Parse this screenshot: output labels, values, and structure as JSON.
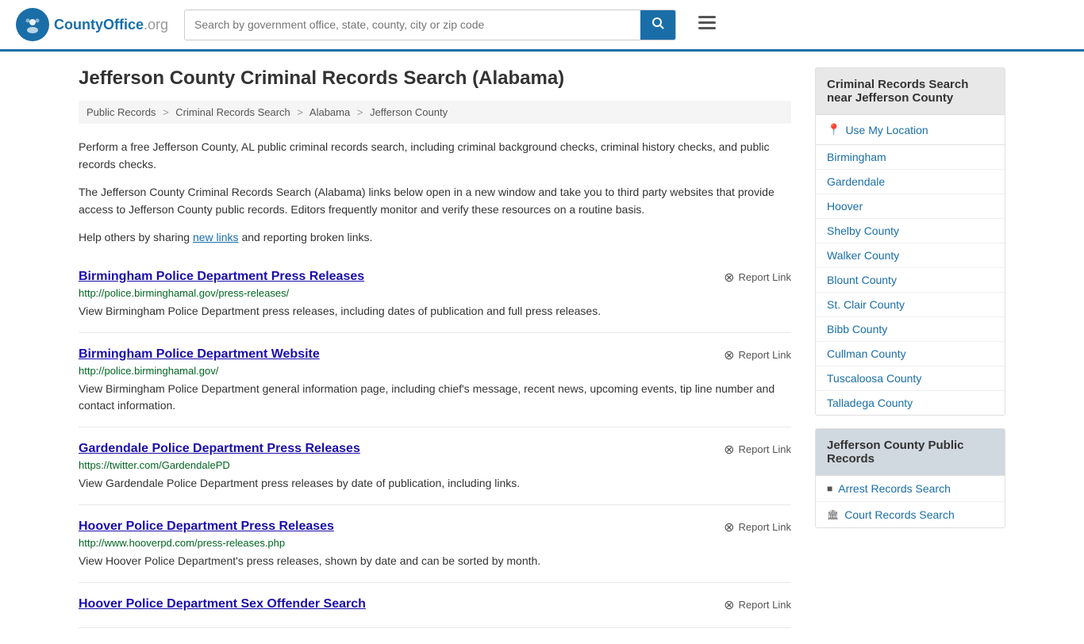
{
  "header": {
    "logo_text": "CountyOffice",
    "logo_suffix": ".org",
    "search_placeholder": "Search by government office, state, county, city or zip code"
  },
  "page": {
    "title": "Jefferson County Criminal Records Search (Alabama)",
    "breadcrumb": [
      {
        "label": "Public Records",
        "href": "#"
      },
      {
        "label": "Criminal Records Search",
        "href": "#"
      },
      {
        "label": "Alabama",
        "href": "#"
      },
      {
        "label": "Jefferson County",
        "href": "#"
      }
    ],
    "description_1": "Perform a free Jefferson County, AL public criminal records search, including criminal background checks, criminal history checks, and public records checks.",
    "description_2": "The Jefferson County Criminal Records Search (Alabama) links below open in a new window and take you to third party websites that provide access to Jefferson County public records. Editors frequently monitor and verify these resources on a routine basis.",
    "description_3_prefix": "Help others by sharing ",
    "description_3_link": "new links",
    "description_3_suffix": " and reporting broken links."
  },
  "results": [
    {
      "title": "Birmingham Police Department Press Releases",
      "url": "http://police.birminghamal.gov/press-releases/",
      "description": "View Birmingham Police Department press releases, including dates of publication and full press releases.",
      "report_label": "Report Link"
    },
    {
      "title": "Birmingham Police Department Website",
      "url": "http://police.birminghamal.gov/",
      "description": "View Birmingham Police Department general information page, including chief's message, recent news, upcoming events, tip line number and contact information.",
      "report_label": "Report Link"
    },
    {
      "title": "Gardendale Police Department Press Releases",
      "url": "https://twitter.com/GardendalePD",
      "description": "View Gardendale Police Department press releases by date of publication, including links.",
      "report_label": "Report Link"
    },
    {
      "title": "Hoover Police Department Press Releases",
      "url": "http://www.hooverpd.com/press-releases.php",
      "description": "View Hoover Police Department's press releases, shown by date and can be sorted by month.",
      "report_label": "Report Link"
    },
    {
      "title": "Hoover Police Department Sex Offender Search",
      "url": "",
      "description": "",
      "report_label": "Report Link"
    }
  ],
  "sidebar": {
    "nearby_section": {
      "title": "Criminal Records Search near Jefferson County",
      "use_location": "Use My Location",
      "links": [
        "Birmingham",
        "Gardendale",
        "Hoover",
        "Shelby County",
        "Walker County",
        "Blount County",
        "St. Clair County",
        "Bibb County",
        "Cullman County",
        "Tuscaloosa County",
        "Talladega County"
      ]
    },
    "public_records_section": {
      "title": "Jefferson County Public Records",
      "links": [
        {
          "icon": "■",
          "label": "Arrest Records Search"
        },
        {
          "icon": "🏛",
          "label": "Court Records Search"
        }
      ]
    }
  }
}
